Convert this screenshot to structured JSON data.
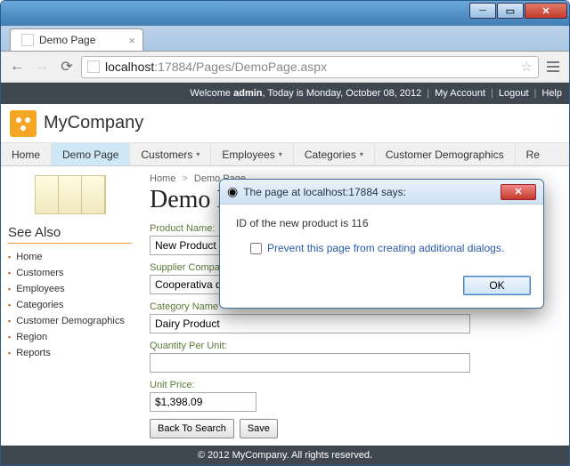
{
  "window": {
    "tab_title": "Demo Page",
    "url_host": "localhost",
    "url_port": ":17884",
    "url_path": "/Pages/DemoPage.aspx"
  },
  "header": {
    "welcome_pre": "Welcome ",
    "user": "admin",
    "date_text": ", Today is Monday, October 08, 2012",
    "my_account": "My Account",
    "logout": "Logout",
    "help": "Help"
  },
  "brand": {
    "name": "MyCompany"
  },
  "menu": {
    "home": "Home",
    "demo": "Demo Page",
    "customers": "Customers",
    "employees": "Employees",
    "categories": "Categories",
    "cust_demo": "Customer Demographics",
    "regions_trunc": "Re"
  },
  "breadcrumb": {
    "home": "Home",
    "current": "Demo Page"
  },
  "page": {
    "title_visible": "Demo P"
  },
  "sidebar": {
    "heading": "See Also",
    "items": [
      "Home",
      "Customers",
      "Employees",
      "Categories",
      "Customer Demographics",
      "Region",
      "Reports"
    ]
  },
  "form": {
    "product_name_label": "Product Name:",
    "product_name_value": "New Product",
    "supplier_label": "Supplier Compa",
    "supplier_value": "Cooperativa d",
    "category_label": "Category Name",
    "category_value": "Dairy Product",
    "qty_label": "Quantity Per Unit:",
    "qty_value": "",
    "price_label": "Unit Price:",
    "price_value": "$1,398.09",
    "back_btn": "Back To Search",
    "save_btn": "Save"
  },
  "footer": {
    "text": "© 2012 MyCompany. All rights reserved."
  },
  "alert": {
    "title": "The page at localhost:17884 says:",
    "message": "ID of the new product is 116",
    "checkbox_label": "Prevent this page from creating additional dialogs.",
    "ok": "OK"
  }
}
